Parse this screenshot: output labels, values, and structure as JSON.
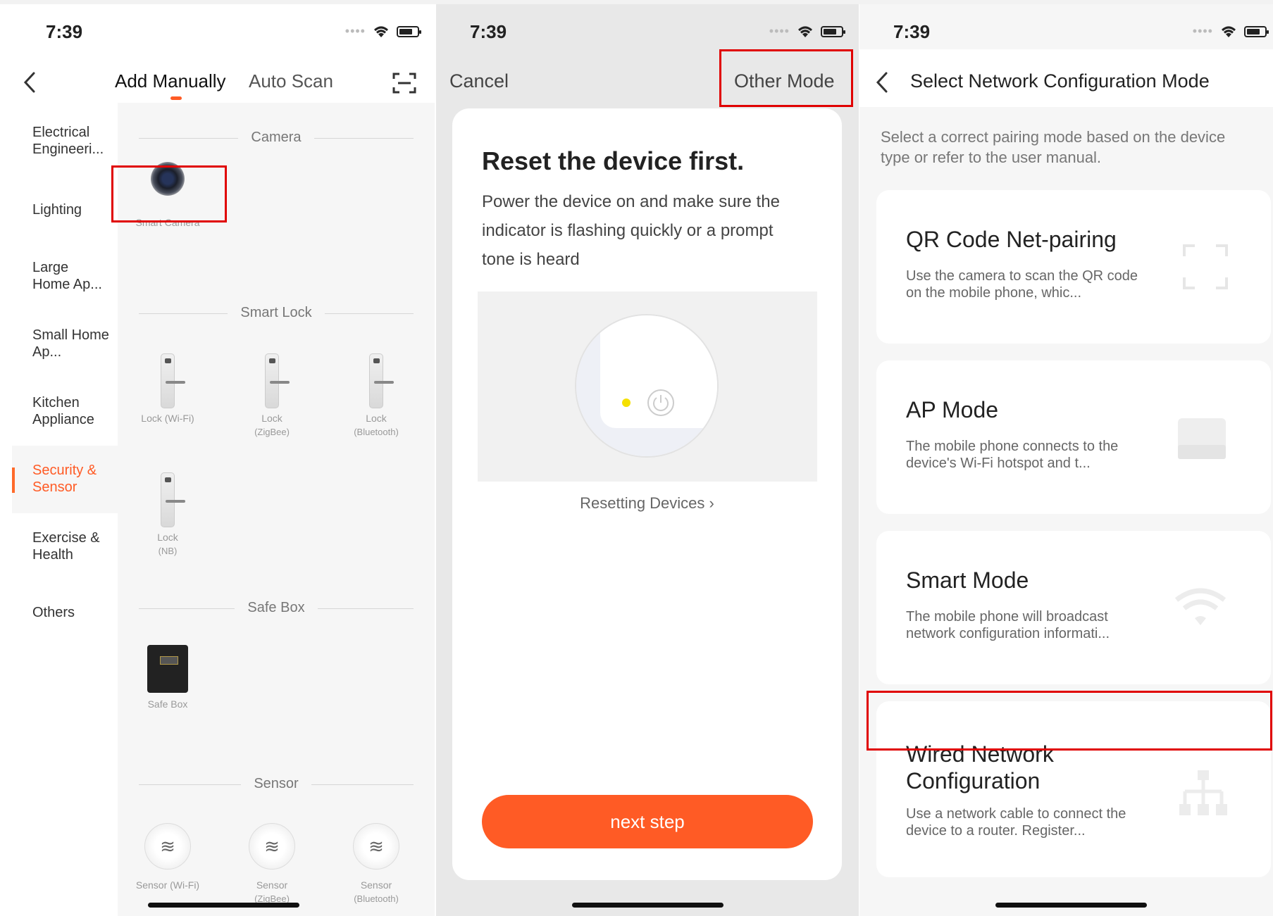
{
  "status": {
    "time": "7:39"
  },
  "screen1": {
    "tabs": {
      "manual": "Add Manually",
      "auto": "Auto Scan"
    },
    "sidebar": [
      {
        "label": "Electrical Engineeri..."
      },
      {
        "label": "Lighting"
      },
      {
        "label": "Large Home Ap..."
      },
      {
        "label": "Small Home Ap..."
      },
      {
        "label": "Kitchen Appliance"
      },
      {
        "label": "Security & Sensor",
        "active": true
      },
      {
        "label": "Exercise & Health"
      },
      {
        "label": "Others"
      }
    ],
    "sections": {
      "camera": "Camera",
      "smart_lock": "Smart Lock",
      "safe_box": "Safe Box",
      "sensor": "Sensor"
    },
    "devices": {
      "smart_camera": "Smart Camera",
      "lock_wifi": "Lock (Wi-Fi)",
      "lock_zigbee": "Lock",
      "lock_zigbee_sub": "(ZigBee)",
      "lock_bt": "Lock",
      "lock_bt_sub": "(Bluetooth)",
      "lock_nb": "Lock",
      "lock_nb_sub": "(NB)",
      "safe_box": "Safe Box",
      "sensor_wifi": "Sensor (Wi-Fi)",
      "sensor_zigbee": "Sensor",
      "sensor_zigbee_sub": "(ZigBee)",
      "sensor_bt": "Sensor",
      "sensor_bt_sub": "(Bluetooth)"
    }
  },
  "screen2": {
    "cancel": "Cancel",
    "other_mode": "Other Mode",
    "title": "Reset the device first.",
    "desc": "Power the device on and make sure the indicator is flashing quickly or a prompt tone is heard",
    "link": "Resetting Devices",
    "next": "next step"
  },
  "screen3": {
    "title": "Select Network Configuration Mode",
    "subtitle": "Select a correct pairing mode based on the device type or refer to the user manual.",
    "modes": [
      {
        "title": "QR Code Net-pairing",
        "desc": "Use the camera to scan the QR code on the mobile phone, whic...",
        "icon": "qr-scan-icon"
      },
      {
        "title": "AP Mode",
        "desc": "The mobile phone connects to the device's Wi-Fi hotspot and t...",
        "icon": "router-icon"
      },
      {
        "title": "Smart Mode",
        "desc": "The mobile phone will broadcast network configuration informati...",
        "icon": "wifi-icon"
      },
      {
        "title": "Wired Network Configuration",
        "desc": "Use a network cable to connect the device to a router. Register...",
        "icon": "network-tree-icon"
      }
    ]
  },
  "colors": {
    "accent": "#ff5b25",
    "highlight": "#e00000"
  }
}
